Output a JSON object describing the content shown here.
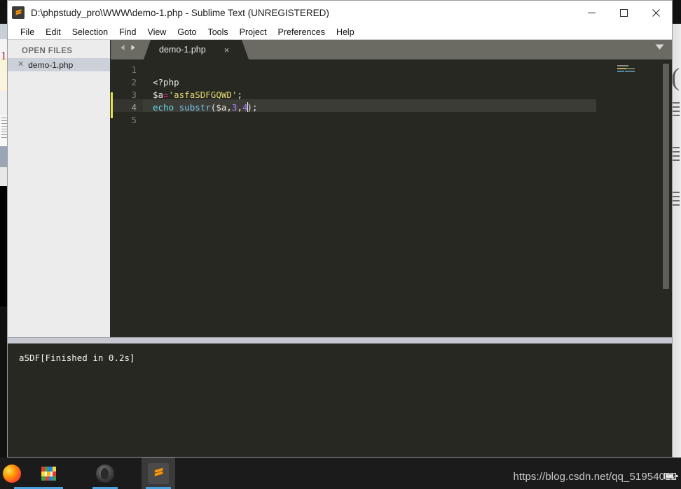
{
  "window": {
    "title": "D:\\phpstudy_pro\\WWW\\demo-1.php - Sublime Text (UNREGISTERED)",
    "logo_icon": "sublime-text-logo-icon",
    "controls": {
      "minimize_icon": "minimize-icon",
      "maximize_icon": "maximize-icon",
      "close_icon": "close-icon"
    }
  },
  "menubar": {
    "items": [
      {
        "label": "File"
      },
      {
        "label": "Edit"
      },
      {
        "label": "Selection"
      },
      {
        "label": "Find"
      },
      {
        "label": "View"
      },
      {
        "label": "Goto"
      },
      {
        "label": "Tools"
      },
      {
        "label": "Project"
      },
      {
        "label": "Preferences"
      },
      {
        "label": "Help"
      }
    ]
  },
  "sidebar": {
    "heading": "OPEN FILES",
    "files": [
      {
        "name": "demo-1.php",
        "close_icon": "close-small-icon"
      }
    ]
  },
  "tabbar": {
    "prev_icon": "arrow-left-icon",
    "next_icon": "arrow-right-icon",
    "chevron_icon": "chevron-down-icon",
    "tabs": [
      {
        "label": "demo-1.php",
        "close": "×",
        "active": true
      }
    ]
  },
  "editor": {
    "line_numbers": [
      "1",
      "2",
      "3",
      "4",
      "5"
    ],
    "active_line": 4,
    "lines": [
      {
        "n": 1,
        "tokens": []
      },
      {
        "n": 2,
        "tokens": [
          {
            "t": "<?php",
            "c": "t-def"
          }
        ]
      },
      {
        "n": 3,
        "tokens": [
          {
            "t": "$a",
            "c": "t-def"
          },
          {
            "t": "=",
            "c": "t-op"
          },
          {
            "t": "'asfaSDFGQWD'",
            "c": "t-str"
          },
          {
            "t": ";",
            "c": "t-punct"
          }
        ]
      },
      {
        "n": 4,
        "tokens": [
          {
            "t": "echo",
            "c": "t-kw"
          },
          {
            "t": " ",
            "c": "t-punct"
          },
          {
            "t": "substr",
            "c": "t-fn"
          },
          {
            "t": "(",
            "c": "t-punct"
          },
          {
            "t": "$a",
            "c": "t-def"
          },
          {
            "t": ",",
            "c": "t-punct"
          },
          {
            "t": "3",
            "c": "t-num"
          },
          {
            "t": ",",
            "c": "t-punct"
          },
          {
            "t": "4",
            "c": "t-num"
          },
          {
            "t": "|CARET|",
            "c": "caret"
          },
          {
            "t": ")",
            "c": "t-punct"
          },
          {
            "t": ";",
            "c": "t-punct"
          }
        ]
      },
      {
        "n": 5,
        "tokens": []
      }
    ],
    "colors": {
      "background": "#272822",
      "active_line": "#3b3c35",
      "gutter_accent": "#e6e24a",
      "keyword": "#66d9ef",
      "function": "#76c5ea",
      "string": "#e6db74",
      "number": "#ae81ff",
      "operator": "#f92672",
      "default_text": "#e8e8e2",
      "line_number": "#7d7f74"
    }
  },
  "console": {
    "output": "aSDF[Finished in 0.2s]"
  },
  "taskbar": {
    "icons": [
      {
        "name": "firefox-icon",
        "label": "Firefox"
      },
      {
        "name": "winrar-icon",
        "label": "WinRAR"
      },
      {
        "name": "steam-icon",
        "label": "Steam"
      },
      {
        "name": "sublime-text-taskbar-icon",
        "label": "Sublime Text",
        "active": true
      }
    ],
    "tray": {
      "battery_icon": "battery-icon"
    }
  },
  "watermark": {
    "text": "https://blog.csdn.net/qq_51954012"
  }
}
